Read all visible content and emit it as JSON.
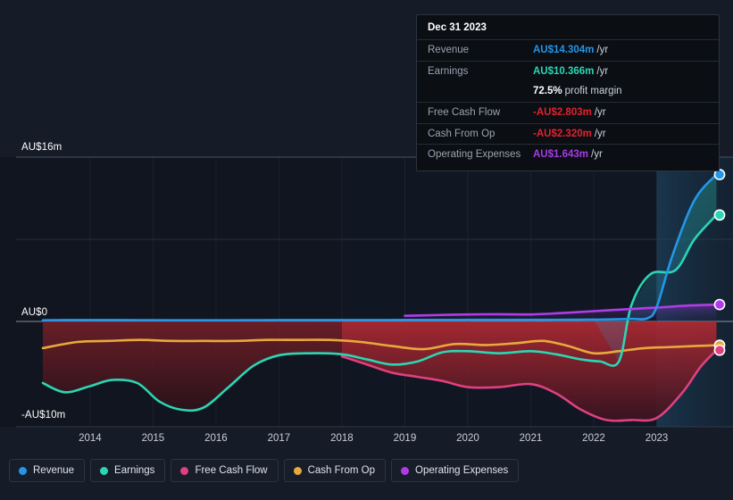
{
  "tooltip": {
    "date": "Dec 31 2023",
    "rows": [
      {
        "label": "Revenue",
        "value": "AU$14.304m",
        "unit": "/yr",
        "color": "#2496e8"
      },
      {
        "label": "Earnings",
        "value": "AU$10.366m",
        "unit": "/yr",
        "color": "#2bd6b4"
      },
      {
        "label": "",
        "value": "72.5%",
        "unit": "profit margin",
        "color": "#ffffff"
      },
      {
        "label": "Free Cash Flow",
        "value": "-AU$2.803m",
        "unit": "/yr",
        "color": "#e0232f"
      },
      {
        "label": "Cash From Op",
        "value": "-AU$2.320m",
        "unit": "/yr",
        "color": "#e0232f"
      },
      {
        "label": "Operating Expenses",
        "value": "AU$1.643m",
        "unit": "/yr",
        "color": "#a63ce8"
      }
    ]
  },
  "legend": {
    "items": [
      {
        "label": "Revenue",
        "color": "#2496e8"
      },
      {
        "label": "Earnings",
        "color": "#2bd6b4"
      },
      {
        "label": "Free Cash Flow",
        "color": "#e0407f"
      },
      {
        "label": "Cash From Op",
        "color": "#e8a93c"
      },
      {
        "label": "Operating Expenses",
        "color": "#b03ce8"
      }
    ]
  },
  "chart_data": {
    "type": "line",
    "title": "",
    "xlabel": "",
    "ylabel": "",
    "currency": "AU$",
    "units": "millions",
    "grid": true,
    "legend_position": "bottom-left",
    "ylim": [
      -10,
      16
    ],
    "xlim": [
      2013.25,
      2024.0
    ],
    "y_ticks": [
      {
        "value": 16,
        "label": "AU$16m"
      },
      {
        "value": 8,
        "label": ""
      },
      {
        "value": 0,
        "label": "AU$0"
      },
      {
        "value": -10,
        "label": "-AU$10m"
      }
    ],
    "y_axis_labels": [
      "AU$16m",
      "AU$0",
      "-AU$10m"
    ],
    "x_ticks": [
      2014,
      2015,
      2016,
      2017,
      2018,
      2019,
      2020,
      2021,
      2022,
      2023
    ],
    "x_tick_labels": [
      "2014",
      "2015",
      "2016",
      "2017",
      "2018",
      "2019",
      "2020",
      "2021",
      "2022",
      "2023"
    ],
    "series": [
      {
        "name": "Revenue",
        "color": "#2496e8",
        "x": [
          2013.25,
          2013.75,
          2014.25,
          2014.75,
          2015.25,
          2015.75,
          2016.25,
          2016.75,
          2017.25,
          2017.75,
          2018.25,
          2018.75,
          2019.25,
          2019.75,
          2020.25,
          2020.75,
          2021.25,
          2021.75,
          2022.0,
          2022.25,
          2022.6,
          2022.85,
          2023.0,
          2023.25,
          2023.6,
          2023.95
        ],
        "y": [
          0.12,
          0.14,
          0.14,
          0.13,
          0.12,
          0.12,
          0.12,
          0.13,
          0.14,
          0.14,
          0.14,
          0.14,
          0.15,
          0.15,
          0.16,
          0.16,
          0.16,
          0.17,
          0.18,
          0.2,
          0.25,
          0.3,
          1.4,
          6.4,
          11.8,
          14.304
        ]
      },
      {
        "name": "Earnings",
        "color": "#2bd6b4",
        "x": [
          2013.25,
          2013.6,
          2014.0,
          2014.35,
          2014.75,
          2015.1,
          2015.45,
          2015.8,
          2016.2,
          2016.6,
          2017.0,
          2017.5,
          2018.0,
          2018.4,
          2018.8,
          2019.2,
          2019.6,
          2020.0,
          2020.5,
          2021.0,
          2021.4,
          2021.8,
          2022.1,
          2022.4,
          2022.6,
          2022.9,
          2023.3,
          2023.6,
          2023.95
        ],
        "y": [
          -6.0,
          -6.9,
          -6.3,
          -5.7,
          -6.0,
          -7.8,
          -8.6,
          -8.4,
          -6.4,
          -4.3,
          -3.3,
          -3.1,
          -3.2,
          -3.7,
          -4.2,
          -3.9,
          -3.0,
          -2.9,
          -3.1,
          -2.9,
          -3.2,
          -3.7,
          -3.9,
          -3.9,
          1.6,
          4.6,
          5.0,
          8.0,
          10.366
        ]
      },
      {
        "name": "Free Cash Flow",
        "color": "#e0407f",
        "x": [
          2018.0,
          2018.4,
          2018.8,
          2019.2,
          2019.6,
          2020.0,
          2020.5,
          2021.0,
          2021.4,
          2021.8,
          2022.2,
          2022.6,
          2023.0,
          2023.4,
          2023.7,
          2023.95
        ],
        "y": [
          -3.4,
          -4.2,
          -5.0,
          -5.4,
          -5.8,
          -6.4,
          -6.4,
          -6.1,
          -7.0,
          -8.6,
          -9.6,
          -9.6,
          -9.4,
          -7.0,
          -4.4,
          -2.803
        ]
      },
      {
        "name": "Cash From Op",
        "color": "#e8a93c",
        "x": [
          2013.25,
          2013.8,
          2014.3,
          2014.8,
          2015.3,
          2015.8,
          2016.3,
          2016.8,
          2017.3,
          2017.8,
          2018.3,
          2018.8,
          2019.3,
          2019.8,
          2020.3,
          2020.8,
          2021.2,
          2021.6,
          2022.0,
          2022.4,
          2022.8,
          2023.2,
          2023.6,
          2023.95
        ],
        "y": [
          -2.6,
          -2.0,
          -1.9,
          -1.8,
          -1.9,
          -1.9,
          -1.9,
          -1.8,
          -1.8,
          -1.8,
          -2.0,
          -2.4,
          -2.7,
          -2.2,
          -2.3,
          -2.1,
          -1.9,
          -2.4,
          -3.1,
          -2.9,
          -2.6,
          -2.5,
          -2.4,
          -2.32
        ]
      },
      {
        "name": "Operating Expenses",
        "color": "#b03ce8",
        "x": [
          2019.0,
          2019.5,
          2020.0,
          2020.5,
          2021.0,
          2021.5,
          2022.0,
          2022.5,
          2023.0,
          2023.5,
          2023.95
        ],
        "y": [
          0.55,
          0.62,
          0.68,
          0.7,
          0.68,
          0.82,
          1.0,
          1.18,
          1.35,
          1.55,
          1.643
        ]
      }
    ],
    "end_markers": [
      {
        "name": "Revenue",
        "value": 14.304,
        "color": "#2496e8"
      },
      {
        "name": "Earnings",
        "value": 10.366,
        "color": "#2bd6b4"
      },
      {
        "name": "Operating Expenses",
        "value": 1.643,
        "color": "#b03ce8"
      },
      {
        "name": "Cash From Op",
        "value": -2.32,
        "color": "#e8a93c"
      },
      {
        "name": "Free Cash Flow",
        "value": -2.803,
        "color": "#e0407f"
      }
    ],
    "shaded_regions": [
      {
        "name": "past-period",
        "from": 2013.25,
        "to": 2018.0
      },
      {
        "name": "reported-period",
        "from": 2018.0,
        "to": 2023.0
      },
      {
        "name": "latest-period",
        "from": 2023.0,
        "to": 2024.0
      }
    ]
  }
}
